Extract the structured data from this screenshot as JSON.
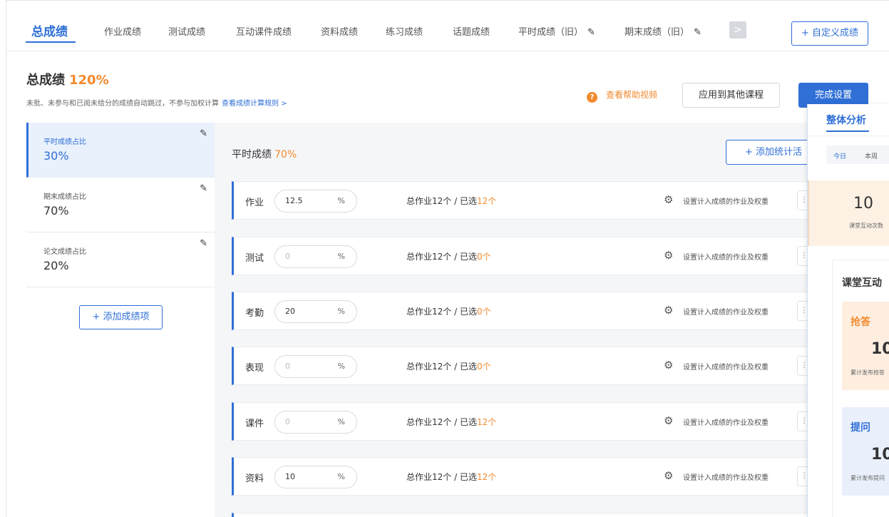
{
  "tabs": [
    {
      "label": "总成绩",
      "active": true
    },
    {
      "label": "作业成绩"
    },
    {
      "label": "测试成绩"
    },
    {
      "label": "互动课件成绩"
    },
    {
      "label": "资料成绩"
    },
    {
      "label": "练习成绩"
    },
    {
      "label": "话题成绩"
    },
    {
      "label": "平时成绩（旧）"
    },
    {
      "label": "期末成绩（旧）"
    }
  ],
  "tab_more": ">",
  "custom_button": "+ 自定义成绩",
  "header": {
    "title": "总成绩",
    "title_pct": "120%",
    "desc": "未批、未参与和已阅未给分的成绩自动跳过，不参与加权计算",
    "rule_link": "查看成绩计算规则 >",
    "help_link": "查看帮助视频",
    "help_icon": "?",
    "apply_button": "应用到其他课程",
    "finish_button": "完成设置"
  },
  "left_items": [
    {
      "label": "平时成绩占比",
      "value": "30%"
    },
    {
      "label": "期末成绩占比",
      "value": "70%"
    },
    {
      "label": "论文成绩占比",
      "value": "20%"
    }
  ],
  "add_item_button": "+ 添加成绩项",
  "section": {
    "title": "平时成绩",
    "pct": "70%",
    "add_stat_button": "+ 添加统计活"
  },
  "rows": [
    {
      "label": "作业",
      "value": "12.5",
      "placeholder": "",
      "unit": "%",
      "total": "总作业12个 / 已选",
      "selected": "12个",
      "setting": "设置计入成绩的作业及权重"
    },
    {
      "label": "测试",
      "value": "",
      "placeholder": "0",
      "unit": "%",
      "total": "总作业12个 / 已选",
      "selected": "0个",
      "setting": "设置计入成绩的作业及权重"
    },
    {
      "label": "考勤",
      "value": "20",
      "placeholder": "",
      "unit": "%",
      "total": "总作业12个 / 已选",
      "selected": "0个",
      "setting": "设置计入成绩的作业及权重"
    },
    {
      "label": "表现",
      "value": "",
      "placeholder": "0",
      "unit": "%",
      "total": "总作业12个 / 已选",
      "selected": "0个",
      "setting": "设置计入成绩的作业及权重"
    },
    {
      "label": "课件",
      "value": "",
      "placeholder": "0",
      "unit": "%",
      "total": "总作业12个 / 已选",
      "selected": "12个",
      "setting": "设置计入成绩的作业及权重"
    },
    {
      "label": "资料",
      "value": "10",
      "placeholder": "",
      "unit": "%",
      "total": "总作业12个 / 已选",
      "selected": "12个",
      "setting": "设置计入成绩的作业及权重"
    }
  ],
  "overlay": {
    "title": "整体分析",
    "range_today": "今日",
    "range_week": "本周",
    "card_count": "10",
    "card_label": "课堂互动次数",
    "box_title": "课堂互动",
    "qiangda": {
      "title": "抢答",
      "count": "10",
      "label": "累计发布抢答"
    },
    "tiwen": {
      "title": "提问",
      "count": "10",
      "label": "累计发布提问"
    }
  },
  "colors": {
    "accent": "#2f6fd6",
    "orange": "#f28a2e"
  }
}
